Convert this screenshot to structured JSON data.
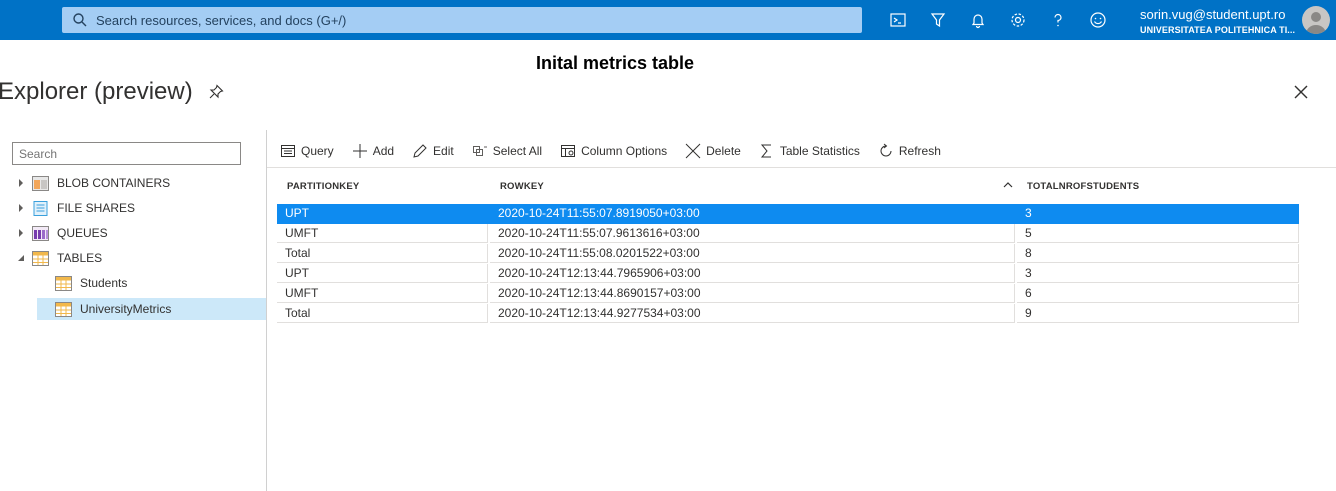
{
  "topbar": {
    "search_placeholder": "Search resources, services, and docs (G+/)",
    "icons": [
      "cloud-shell-icon",
      "directory-filter-icon",
      "bell-icon",
      "gear-icon",
      "help-icon",
      "feedback-smiley-icon"
    ],
    "account_email": "sorin.vug@student.upt.ro",
    "account_org": "UNIVERSITATEA POLITEHNICA TI..."
  },
  "caption": "Inital metrics table",
  "blade": {
    "title": "Explorer (preview)"
  },
  "tree": {
    "search_placeholder": "Search",
    "items": [
      {
        "label": "BLOB CONTAINERS",
        "icon": "blob-container-icon",
        "expanded": false
      },
      {
        "label": "FILE SHARES",
        "icon": "file-share-icon",
        "expanded": false
      },
      {
        "label": "QUEUES",
        "icon": "queue-icon",
        "expanded": false
      },
      {
        "label": "TABLES",
        "icon": "table-icon",
        "expanded": true
      }
    ],
    "tables": [
      {
        "label": "Students",
        "selected": false
      },
      {
        "label": "UniversityMetrics",
        "selected": true
      }
    ]
  },
  "toolbar": {
    "query": "Query",
    "add": "Add",
    "edit": "Edit",
    "select_all": "Select All",
    "column_options": "Column Options",
    "delete": "Delete",
    "table_statistics": "Table Statistics",
    "refresh": "Refresh"
  },
  "table": {
    "columns": [
      "PARTITIONKEY",
      "ROWKEY",
      "TOTALNROFSTUDENTS"
    ],
    "rows": [
      {
        "partitionkey": "UPT",
        "rowkey": "2020-10-24T11:55:07.8919050+03:00",
        "total": "3",
        "selected": true
      },
      {
        "partitionkey": "UMFT",
        "rowkey": "2020-10-24T11:55:07.9613616+03:00",
        "total": "5",
        "selected": false
      },
      {
        "partitionkey": "Total",
        "rowkey": "2020-10-24T11:55:08.0201522+03:00",
        "total": "8",
        "selected": false
      },
      {
        "partitionkey": "UPT",
        "rowkey": "2020-10-24T12:13:44.7965906+03:00",
        "total": "3",
        "selected": false
      },
      {
        "partitionkey": "UMFT",
        "rowkey": "2020-10-24T12:13:44.8690157+03:00",
        "total": "6",
        "selected": false
      },
      {
        "partitionkey": "Total",
        "rowkey": "2020-10-24T12:13:44.9277534+03:00",
        "total": "9",
        "selected": false
      }
    ]
  },
  "colors": {
    "topbar": "#0072c6",
    "selected_row": "#0e8bf0",
    "selected_node": "#cce8f9"
  }
}
